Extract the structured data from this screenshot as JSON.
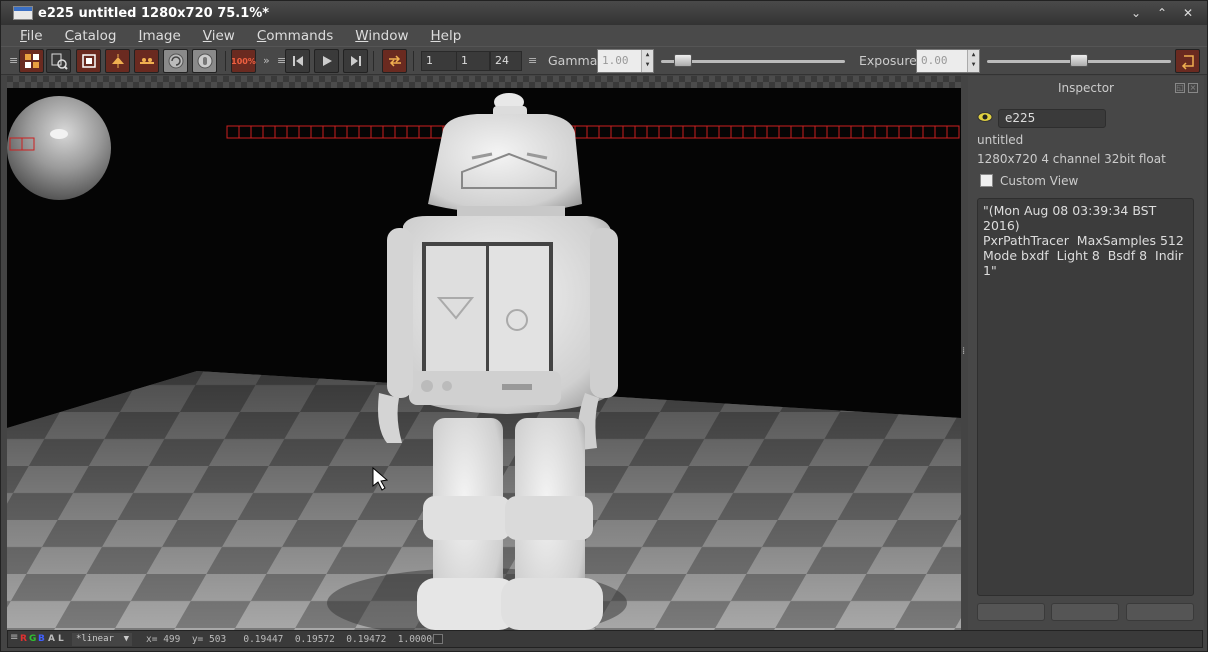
{
  "window": {
    "title": "e225 untitled 1280x720 75.1%*"
  },
  "menu": [
    "File",
    "Catalog",
    "Image",
    "View",
    "Commands",
    "Window",
    "Help"
  ],
  "toolbar": {
    "zoom_label": "100%",
    "frames": {
      "start": "1",
      "current": "1",
      "end": "24"
    },
    "gamma_label": "Gamma",
    "gamma_value": "1.00",
    "gamma_slider": 0.08,
    "exposure_label": "Exposure",
    "exposure_value": "0.00",
    "exposure_slider": 0.5
  },
  "inspector": {
    "title": "Inspector",
    "image_name": "e225",
    "subtitle": "untitled",
    "resolution": "1280x720 4 channel 32bit float",
    "custom_view_label": "Custom View",
    "custom_view_checked": false,
    "info_text": "\"(Mon Aug 08 03:39:34 BST 2016)\nPxrPathTracer  MaxSamples 512 Mode bxdf  Light 8  Bsdf 8  Indir 1\""
  },
  "status": {
    "channels": [
      "R",
      "G",
      "B",
      "A",
      "L"
    ],
    "channel_colors": [
      "#e03030",
      "#30c030",
      "#4060ff",
      "#bbbbbb",
      "#bbbbbb"
    ],
    "colorspace": "*linear",
    "x_label": "x=",
    "x_value": "499",
    "y_label": "y=",
    "y_value": "503",
    "pixel_values": "0.19447  0.19572  0.19472  1.00000"
  },
  "colors": {
    "accent": "#6a2a20",
    "bucket_outline": "#cc2020"
  }
}
